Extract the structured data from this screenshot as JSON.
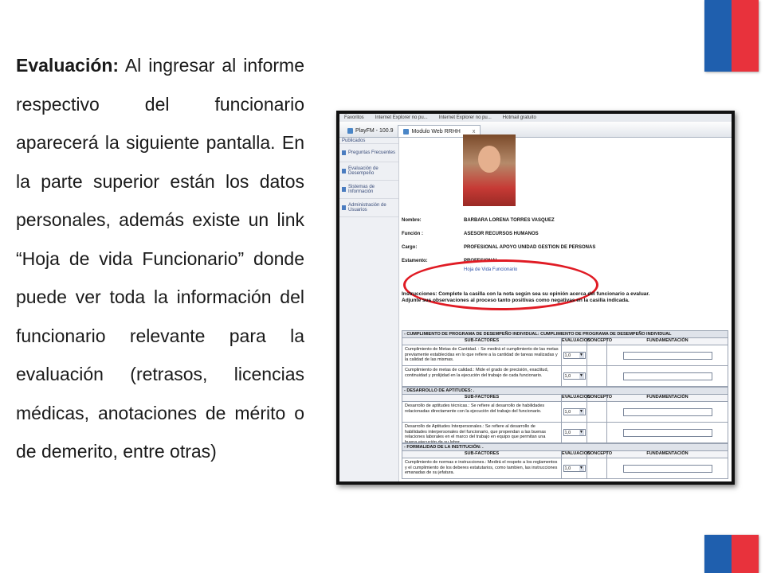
{
  "colors": {
    "flag_blue": "#1f5fae",
    "flag_red": "#e8323c",
    "highlight_ellipse": "#e01b24",
    "link": "#2a4fa8"
  },
  "paragraph": {
    "lead": "Evaluación:",
    "text": " Al ingresar al informe respectivo del funcionario aparecerá la siguiente pantalla. En la parte superior están los datos personales, además existe un link “Hoja de vida Funcionario” donde puede ver toda la información del funcionario relevante para la evaluación (retrasos, licencias médicas, anotaciones de mérito o de demerito, entre otras)"
  },
  "browser": {
    "favorites": [
      "Favoritos",
      "Internet Explorer no pu...",
      "Internet Explorer no pu...",
      "Hotmail gratuito"
    ],
    "tabs": [
      {
        "label": "PlayFM - 100.9",
        "icon": "radio-icon"
      },
      {
        "label": "Modulo Web RRHH",
        "icon": "page-icon",
        "close": "x"
      }
    ]
  },
  "sidebar": {
    "items": [
      {
        "label": "Publicados"
      },
      {
        "label": "Preguntas Frecuentes"
      },
      {
        "label": "Evaluación de Desempeño"
      },
      {
        "label": "Sistemas de Información"
      },
      {
        "label": "Administración de Usuarios"
      }
    ]
  },
  "employee": {
    "fields": [
      {
        "label": "Nombre:",
        "value": "BARBARA LORENA TORRES VASQUEZ"
      },
      {
        "label": "Función :",
        "value": "ASESOR RECURSOS HUMANOS"
      },
      {
        "label": "Cargo:",
        "value": "PROFESIONAL APOYO UNIDAD GESTION DE PERSONAS"
      },
      {
        "label": "Estamento:",
        "value": "PROFESIONAL"
      }
    ],
    "link": "Hoja de Vida Funcionario"
  },
  "instructions": "Instrucciones: Complete la casilla con la nota según sea su opinión acerca del funcionario a evaluar. Adjunte sus observaciones al proceso tanto positivas como negativas en la casilla indicada.",
  "evaluation": {
    "headers": {
      "sub": "SUB-FACTORES",
      "eval": "EVALUACION",
      "concept": "CONCEPTO",
      "basis": "FUNDAMENTACIÓN"
    },
    "sections": [
      {
        "title": "- CUMPLIMIENTO DE PROGRAMA DE DESEMPEÑO INDIVIDUAL: CUMPLIMIENTO DE PROGRAMA DE DESEMPEÑO INDIVIDUAL",
        "rows": [
          {
            "text": "Cumplimiento de Metas de Cantidad. : Se medirá el cumplimiento de las metas previamente establecidas en lo que refiere a la cantidad de tareas realizadas y la calidad de las mismas.",
            "value": "1,0"
          },
          {
            "text": "Cumplimiento de metas de calidad.: Mide el grado de precisión, exactitud, continuidad y prolijidad en la ejecución del trabajo de cada funcionario.",
            "value": "1,0"
          }
        ]
      },
      {
        "title": "- DESARROLLO DE APTITUDES: .",
        "rows": [
          {
            "text": "Desarrollo de aptitudes técnicas.: Se refiere al desarrollo de habilidades relacionadas directamente con la ejecución del trabajo del funcionario.",
            "value": "1,0"
          },
          {
            "text": "Desarrollo de Aptitudes Interpersonales.: Se refiere al desarrollo de habilidades interpersonales del funcionario, que propendan a las buenas relaciones laborales en el marco del trabajo en equipo que permitan una buena ejecución de su labor.",
            "value": "1,0"
          }
        ]
      },
      {
        "title": "- FORMALIDAD DE LA INSTITUCIÓN: .",
        "rows": [
          {
            "text": "Cumplimiento de normas e instrucciones.: Medirá el respeto a los reglamentos y el cumplimiento de los deberes estatutarios, como tambien, las instrucciones emanadas de su jefatura.",
            "value": "1,0"
          }
        ]
      }
    ]
  }
}
